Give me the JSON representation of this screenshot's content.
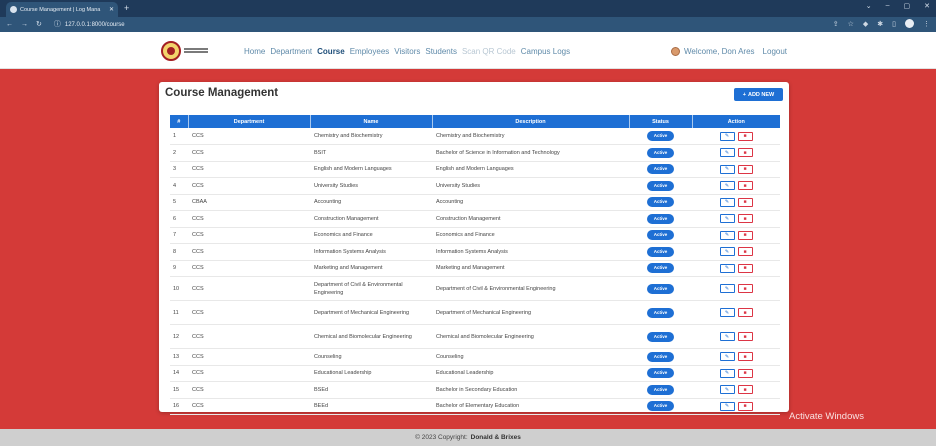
{
  "browser": {
    "tab_title": "Course Management | Log Mana",
    "url": "127.0.0.1:8000/course"
  },
  "navbar": {
    "links": [
      "Home",
      "Department",
      "Course",
      "Employees",
      "Visitors",
      "Students",
      "Scan QR Code",
      "Campus Logs"
    ],
    "welcome": "Welcome, Don Ares",
    "logout": "Logout"
  },
  "page": {
    "title": "Course Management",
    "add_button": "ADD NEW"
  },
  "table": {
    "headers": [
      "#",
      "Department",
      "Name",
      "Description",
      "Status",
      "Action"
    ],
    "rows": [
      {
        "id": "1",
        "dept": "CCS",
        "name": "Chemistry and Biochemistry",
        "desc": "Chemistry and Biochemistry",
        "status": "Active"
      },
      {
        "id": "2",
        "dept": "CCS",
        "name": "BSIT",
        "desc": "Bachelor of Science in Information and Technology",
        "status": "Active"
      },
      {
        "id": "3",
        "dept": "CCS",
        "name": "English and Modern Languages",
        "desc": "English and Modern Languages",
        "status": "Active"
      },
      {
        "id": "4",
        "dept": "CCS",
        "name": "University Studies",
        "desc": "University Studies",
        "status": "Active"
      },
      {
        "id": "5",
        "dept": "CBAA",
        "name": "Accounting",
        "desc": "Accounting",
        "status": "Active"
      },
      {
        "id": "6",
        "dept": "CCS",
        "name": "Construction Management",
        "desc": "Construction Management",
        "status": "Active"
      },
      {
        "id": "7",
        "dept": "CCS",
        "name": "Economics and Finance",
        "desc": "Economics and Finance",
        "status": "Active"
      },
      {
        "id": "8",
        "dept": "CCS",
        "name": "Information Systems Analysis",
        "desc": "Information Systems Analysis",
        "status": "Active"
      },
      {
        "id": "9",
        "dept": "CCS",
        "name": "Marketing and Management",
        "desc": "Marketing and Management",
        "status": "Active"
      },
      {
        "id": "10",
        "dept": "CCS",
        "name": "Department of Civil & Environmental Engineering",
        "desc": "Department of Civil & Environmental Engineering",
        "status": "Active"
      },
      {
        "id": "11",
        "dept": "CCS",
        "name": "Department of Mechanical Engineering",
        "desc": "Department of Mechanical Engineering",
        "status": "Active"
      },
      {
        "id": "12",
        "dept": "CCS",
        "name": "Chemical and Biomolecular Engineering",
        "desc": "Chemical and Biomolecular Engineering",
        "status": "Active"
      },
      {
        "id": "13",
        "dept": "CCS",
        "name": "Counseling",
        "desc": "Counseling",
        "status": "Active"
      },
      {
        "id": "14",
        "dept": "CCS",
        "name": "Educational Leadership",
        "desc": "Educational Leadership",
        "status": "Active"
      },
      {
        "id": "15",
        "dept": "CCS",
        "name": "BSEd",
        "desc": "Bachelor in Secondary Education",
        "status": "Active"
      },
      {
        "id": "16",
        "dept": "CCS",
        "name": "BEEd",
        "desc": "Bachelor of Elementary Education",
        "status": "Active"
      }
    ]
  },
  "watermark": "Activate Windows",
  "footer": {
    "copyright": "© 2023 Copyright:",
    "owner": "Donald & Brixes"
  },
  "colors": {
    "accent": "#1e6fd4",
    "hero": "#d43a38",
    "danger": "#dc3545"
  }
}
